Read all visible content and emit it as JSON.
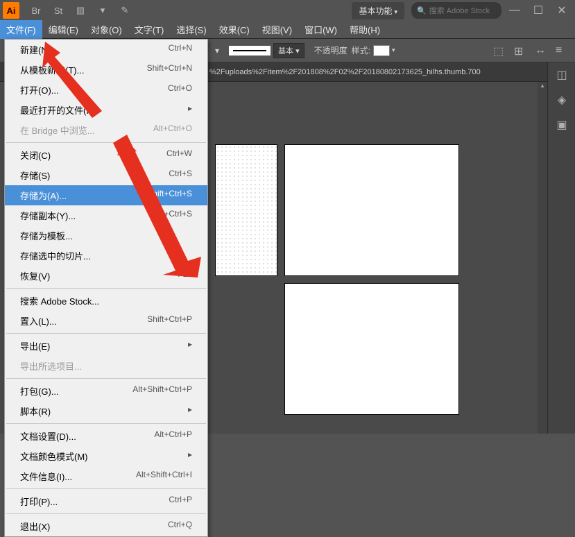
{
  "titlebar": {
    "logo": "Ai",
    "workspace": "基本功能",
    "search_placeholder": "搜索 Adobe Stock"
  },
  "menubar": {
    "items": [
      "文件(F)",
      "编辑(E)",
      "对象(O)",
      "文字(T)",
      "选择(S)",
      "效果(C)",
      "视图(V)",
      "窗口(W)",
      "帮助(H)"
    ]
  },
  "toolbar": {
    "stroke_style": "基本",
    "opacity_label": "不透明度",
    "style_label": "样式:"
  },
  "tabbar": {
    "path": "%2Fuploads%2Fitem%2F201808%2F02%2F20180802173625_hilhs.thumb.700"
  },
  "file_menu": {
    "items": [
      {
        "label": "新建(N)...",
        "shortcut": "Ctrl+N",
        "type": "item"
      },
      {
        "label": "从模板新建(T)...",
        "shortcut": "Shift+Ctrl+N",
        "type": "item"
      },
      {
        "label": "打开(O)...",
        "shortcut": "Ctrl+O",
        "type": "item"
      },
      {
        "label": "最近打开的文件(F)",
        "shortcut": "",
        "type": "submenu"
      },
      {
        "label": "在 Bridge 中浏览...",
        "shortcut": "Alt+Ctrl+O",
        "type": "disabled"
      },
      {
        "type": "sep"
      },
      {
        "label": "关闭(C)",
        "shortcut": "Ctrl+W",
        "type": "item"
      },
      {
        "label": "存储(S)",
        "shortcut": "Ctrl+S",
        "type": "item"
      },
      {
        "label": "存储为(A)...",
        "shortcut": "Shift+Ctrl+S",
        "type": "highlight"
      },
      {
        "label": "存储副本(Y)...",
        "shortcut": "Alt+Ctrl+S",
        "type": "item"
      },
      {
        "label": "存储为模板...",
        "shortcut": "",
        "type": "item"
      },
      {
        "label": "存储选中的切片...",
        "shortcut": "",
        "type": "item"
      },
      {
        "label": "恢复(V)",
        "shortcut": "F12",
        "type": "item"
      },
      {
        "type": "sep"
      },
      {
        "label": "搜索 Adobe Stock...",
        "shortcut": "",
        "type": "item"
      },
      {
        "label": "置入(L)...",
        "shortcut": "Shift+Ctrl+P",
        "type": "item"
      },
      {
        "type": "sep"
      },
      {
        "label": "导出(E)",
        "shortcut": "",
        "type": "submenu"
      },
      {
        "label": "导出所选项目...",
        "shortcut": "",
        "type": "disabled"
      },
      {
        "type": "sep"
      },
      {
        "label": "打包(G)...",
        "shortcut": "Alt+Shift+Ctrl+P",
        "type": "item"
      },
      {
        "label": "脚本(R)",
        "shortcut": "",
        "type": "submenu"
      },
      {
        "type": "sep"
      },
      {
        "label": "文档设置(D)...",
        "shortcut": "Alt+Ctrl+P",
        "type": "item"
      },
      {
        "label": "文档颜色模式(M)",
        "shortcut": "",
        "type": "submenu"
      },
      {
        "label": "文件信息(I)...",
        "shortcut": "Alt+Shift+Ctrl+I",
        "type": "item"
      },
      {
        "type": "sep"
      },
      {
        "label": "打印(P)...",
        "shortcut": "Ctrl+P",
        "type": "item"
      },
      {
        "type": "sep"
      },
      {
        "label": "退出(X)",
        "shortcut": "Ctrl+Q",
        "type": "item"
      }
    ]
  }
}
